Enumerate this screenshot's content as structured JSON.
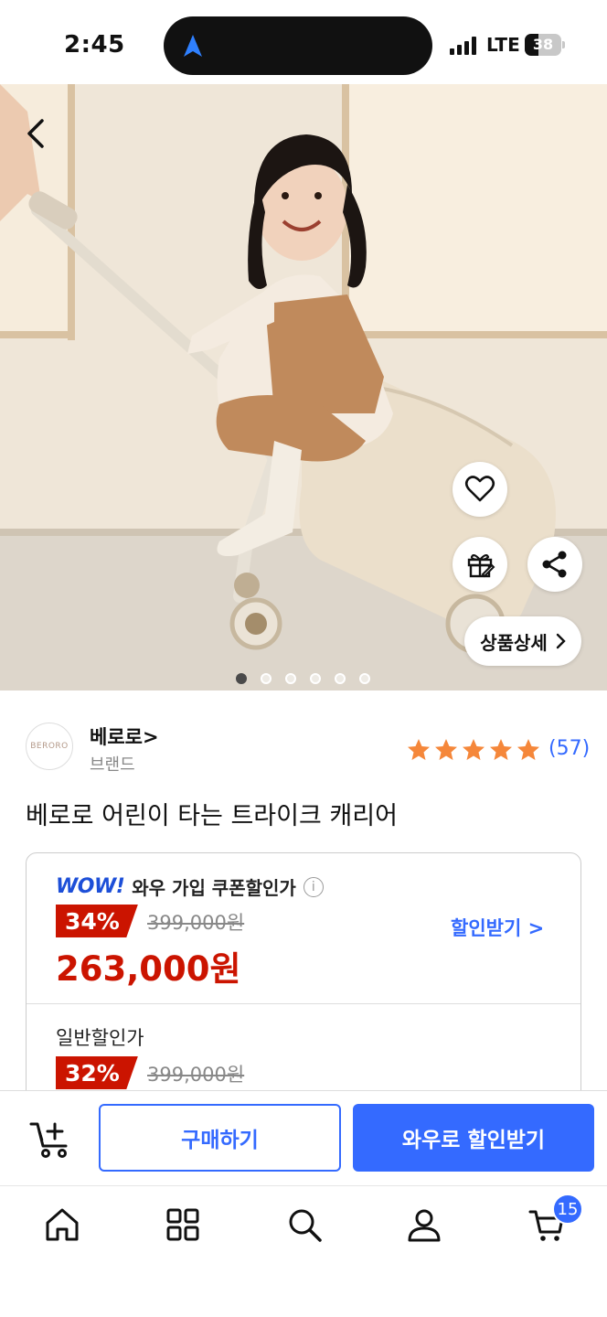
{
  "status_bar": {
    "time": "2:45",
    "network": "LTE",
    "battery_level": "38",
    "battery_fraction": 0.38
  },
  "hero": {
    "image_count": 6,
    "active_index": 0,
    "detail_button_label": "상품상세",
    "icons": [
      "back-icon",
      "heart-icon",
      "gift-icon",
      "share-icon",
      "chevron-right-icon"
    ]
  },
  "brand": {
    "logo_text": "BERORO",
    "name": "베로로",
    "name_suffix": ">",
    "subtitle": "브랜드"
  },
  "rating": {
    "stars": 5,
    "count": "(57)"
  },
  "product": {
    "title": "베로로 어린이 타는 트라이크 캐리어"
  },
  "pricing": {
    "wow_logo": "WOW!",
    "wow_label": "와우 가입 쿠폰할인가",
    "wow_discount": "34%",
    "wow_original": "399,000원",
    "wow_final": "263,000원",
    "coupon_link": "할인받기",
    "coupon_chevron": ">",
    "normal_label": "일반할인가",
    "normal_discount": "32%",
    "normal_original": "399,000원"
  },
  "actions": {
    "buy_label": "구매하기",
    "wow_buy_label": "와우로 할인받기"
  },
  "bottom_nav": {
    "items": [
      "home-icon",
      "category-icon",
      "search-icon",
      "account-icon",
      "cart-icon"
    ],
    "cart_count": "15"
  },
  "colors": {
    "accent": "#346aff",
    "sale": "#cb1400",
    "star": "#f5873a"
  }
}
